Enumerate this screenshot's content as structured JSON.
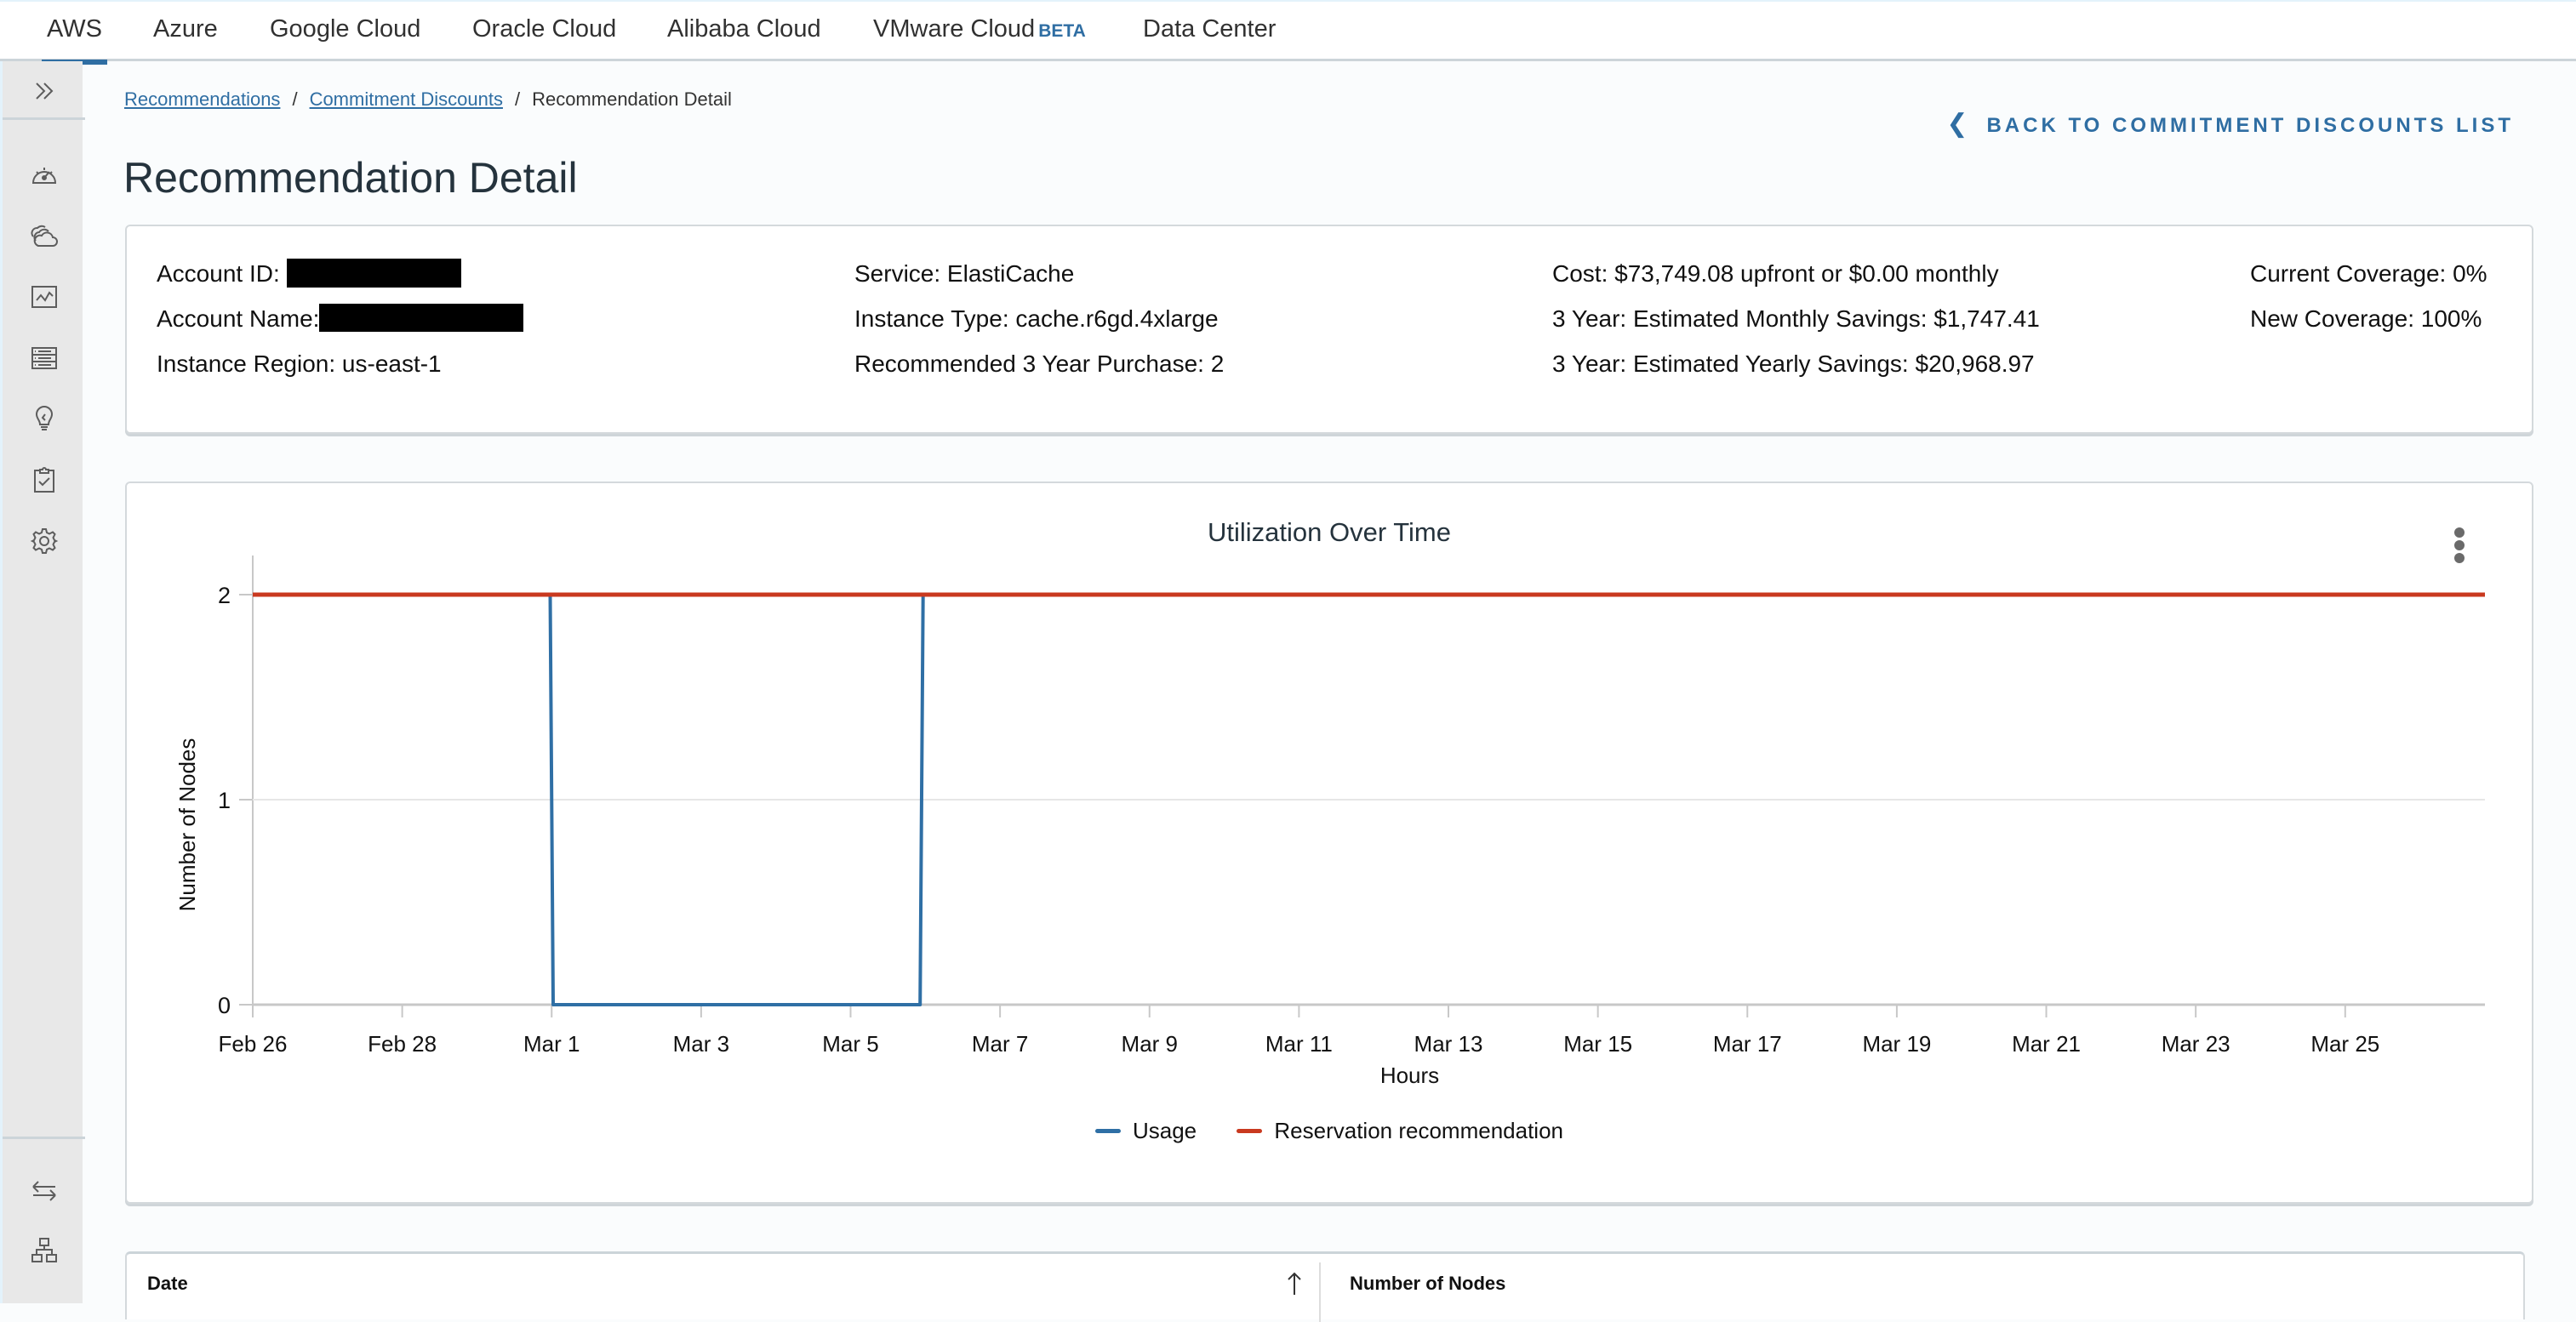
{
  "topnav": {
    "tabs": [
      {
        "label": "AWS",
        "active": true
      },
      {
        "label": "Azure"
      },
      {
        "label": "Google Cloud"
      },
      {
        "label": "Oracle Cloud"
      },
      {
        "label": "Alibaba Cloud"
      },
      {
        "label": "VMware Cloud",
        "badge": "BETA"
      },
      {
        "label": "Data Center"
      }
    ],
    "accent_color": "#2f6ea3"
  },
  "sidebar": {
    "toggle_icon": "chevron-double-right-icon",
    "items": [
      {
        "icon": "dashboard-gauge-icon"
      },
      {
        "icon": "clouds-icon"
      },
      {
        "icon": "line-chart-icon"
      },
      {
        "icon": "server-list-icon"
      },
      {
        "icon": "lightbulb-icon"
      },
      {
        "icon": "clipboard-check-icon"
      },
      {
        "icon": "gear-icon"
      }
    ],
    "bottom_items": [
      {
        "icon": "swap-arrows-icon"
      },
      {
        "icon": "hierarchy-icon"
      }
    ]
  },
  "breadcrumb": {
    "items": [
      "Recommendations",
      "Commitment Discounts"
    ],
    "current": "Recommendation Detail",
    "separator": "/"
  },
  "back_link": "BACK TO COMMITMENT DISCOUNTS LIST",
  "page_title": "Recommendation Detail",
  "info": {
    "account_id_label": "Account ID:",
    "account_id_value": "[redacted]",
    "account_name_label": "Account Name:",
    "account_name_value": "[redacted]",
    "instance_region": "Instance Region: us-east-1",
    "service": "Service: ElastiCache",
    "instance_type": "Instance Type: cache.r6gd.4xlarge",
    "recommended_purchase": "Recommended 3 Year Purchase: 2",
    "cost": "Cost: $73,749.08 upfront or $0.00 monthly",
    "monthly_savings": "3 Year: Estimated Monthly Savings: $1,747.41",
    "yearly_savings": "3 Year: Estimated Yearly Savings: $20,968.97",
    "current_coverage": "Current Coverage: 0%",
    "new_coverage": "New Coverage: 100%"
  },
  "chart_data": {
    "type": "line",
    "title": "Utilization Over Time",
    "xlabel": "Hours",
    "ylabel": "Number of Nodes",
    "x_range_days_from_feb26": [
      0,
      29.87
    ],
    "xticks": [
      "Feb 26",
      "Feb 28",
      "Mar 1",
      "Mar 3",
      "Mar 5",
      "Mar 7",
      "Mar 9",
      "Mar 11",
      "Mar 13",
      "Mar 15",
      "Mar 17",
      "Mar 19",
      "Mar 21",
      "Mar 23",
      "Mar 25"
    ],
    "xtick_days": [
      0,
      2,
      4,
      6,
      8,
      10,
      12,
      14,
      16,
      18,
      20,
      22,
      24,
      26,
      28
    ],
    "yticks": [
      0,
      1,
      2
    ],
    "ylim": [
      0,
      2.1
    ],
    "grid": "horizontal",
    "legend": "bottom-center",
    "series": [
      {
        "name": "Usage",
        "color": "#2f6fa5",
        "points_day_value": [
          [
            3.98,
            2
          ],
          [
            4.02,
            0
          ],
          [
            8.93,
            0
          ],
          [
            8.97,
            2
          ],
          [
            29.87,
            2
          ]
        ]
      },
      {
        "name": "Reservation recommendation",
        "color": "#c9391f",
        "points_day_value": [
          [
            0,
            2
          ],
          [
            29.87,
            2
          ]
        ]
      }
    ]
  },
  "table": {
    "columns": [
      {
        "label": "Date",
        "sort": "ascending"
      },
      {
        "label": "Number of Nodes"
      }
    ]
  }
}
